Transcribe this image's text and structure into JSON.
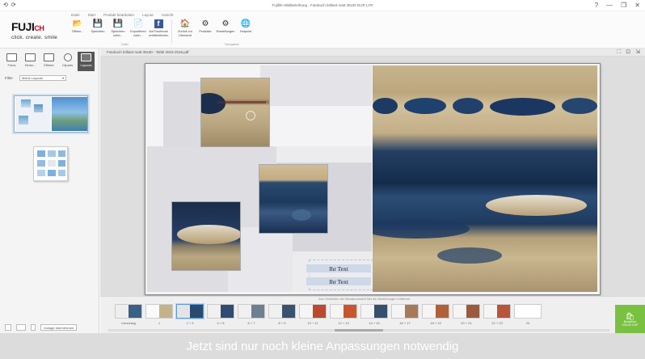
{
  "window": {
    "title": "Fujifilm Bildbelichtung - Fotobuch brillant matt 30x30 DUR LYR",
    "controls": [
      "?",
      "—",
      "❐",
      "✕"
    ]
  },
  "quick_access": [
    "⟲",
    "⟳"
  ],
  "logo": {
    "brand": "FUJI",
    "suffix": "CH",
    "tagline": "click. create. smile"
  },
  "ribbon": {
    "tabs": [
      "Datei",
      "Start",
      "Produkt bearbeiten",
      "Layout",
      "Ansicht"
    ],
    "buttons": [
      {
        "icon": "📂",
        "label": "Öffnen...",
        "name": "open-button"
      },
      {
        "icon": "💾",
        "label": "Speichern",
        "name": "save-button"
      },
      {
        "icon": "💾",
        "label": "Speichern unter...",
        "name": "save-as-button"
      },
      {
        "icon": "📄",
        "label": "Exportieren nach...",
        "name": "export-button"
      },
      {
        "icon": "f",
        "label": "Auf Facebook veröffentlichen",
        "name": "facebook-button"
      },
      {
        "icon": "🏠",
        "label": "Zurück zur Übersicht",
        "name": "home-button"
      },
      {
        "icon": "⚙",
        "label": "Produkte",
        "name": "products-button"
      },
      {
        "icon": "⚙",
        "label": "Einstellungen",
        "name": "settings-button"
      },
      {
        "icon": "🌐",
        "label": "Hotpoint",
        "name": "web-button"
      }
    ],
    "groups": [
      "Datei",
      "Navigation"
    ]
  },
  "left_panel": {
    "tools": [
      {
        "label": "Fotos",
        "active": false
      },
      {
        "label": "Hinter...",
        "active": false
      },
      {
        "label": "Effekte",
        "active": false
      },
      {
        "label": "Cliparts",
        "active": false
      },
      {
        "label": "Layouts",
        "active": true
      }
    ],
    "filter_label": "Filter",
    "filter_value": "Meine Layouts",
    "bottom_label": "Vorlage übernehmen"
  },
  "doc": {
    "filename": "Fotobuch brillant matt 30x30 - Tahiti 2015-2016.pdf",
    "controls": [
      "⛶",
      "⊡",
      "⇲"
    ]
  },
  "canvas": {
    "text_boxes": [
      "Ihr Text",
      "Ihr Text"
    ]
  },
  "filmstrip": {
    "header": "Zum Schließen der Miniaturansicht hier die Markierungen entfernen",
    "thumbs": [
      {
        "label": "Umschlag",
        "selected": false
      },
      {
        "label": "1",
        "selected": false
      },
      {
        "label": "2 + 3",
        "selected": true
      },
      {
        "label": "4 + 5",
        "selected": false
      },
      {
        "label": "6 + 7",
        "selected": false
      },
      {
        "label": "8 + 9",
        "selected": false
      },
      {
        "label": "10 + 11",
        "selected": false
      },
      {
        "label": "12 + 13",
        "selected": false
      },
      {
        "label": "14 + 15",
        "selected": false
      },
      {
        "label": "16 + 17",
        "selected": false
      },
      {
        "label": "18 + 19",
        "selected": false
      },
      {
        "label": "20 + 21",
        "selected": false
      },
      {
        "label": "22 + 23",
        "selected": false
      },
      {
        "label": "24",
        "selected": false
      }
    ],
    "order_button": {
      "label": "Bestellen",
      "price": "125,00 CHF"
    }
  },
  "banner": {
    "text": "Jetzt sind nur noch kleine Anpassungen notwendig"
  },
  "colors": {
    "accent_green": "#7ac142",
    "brand_red": "#d4001a",
    "selection_blue": "#5b9bd5"
  }
}
